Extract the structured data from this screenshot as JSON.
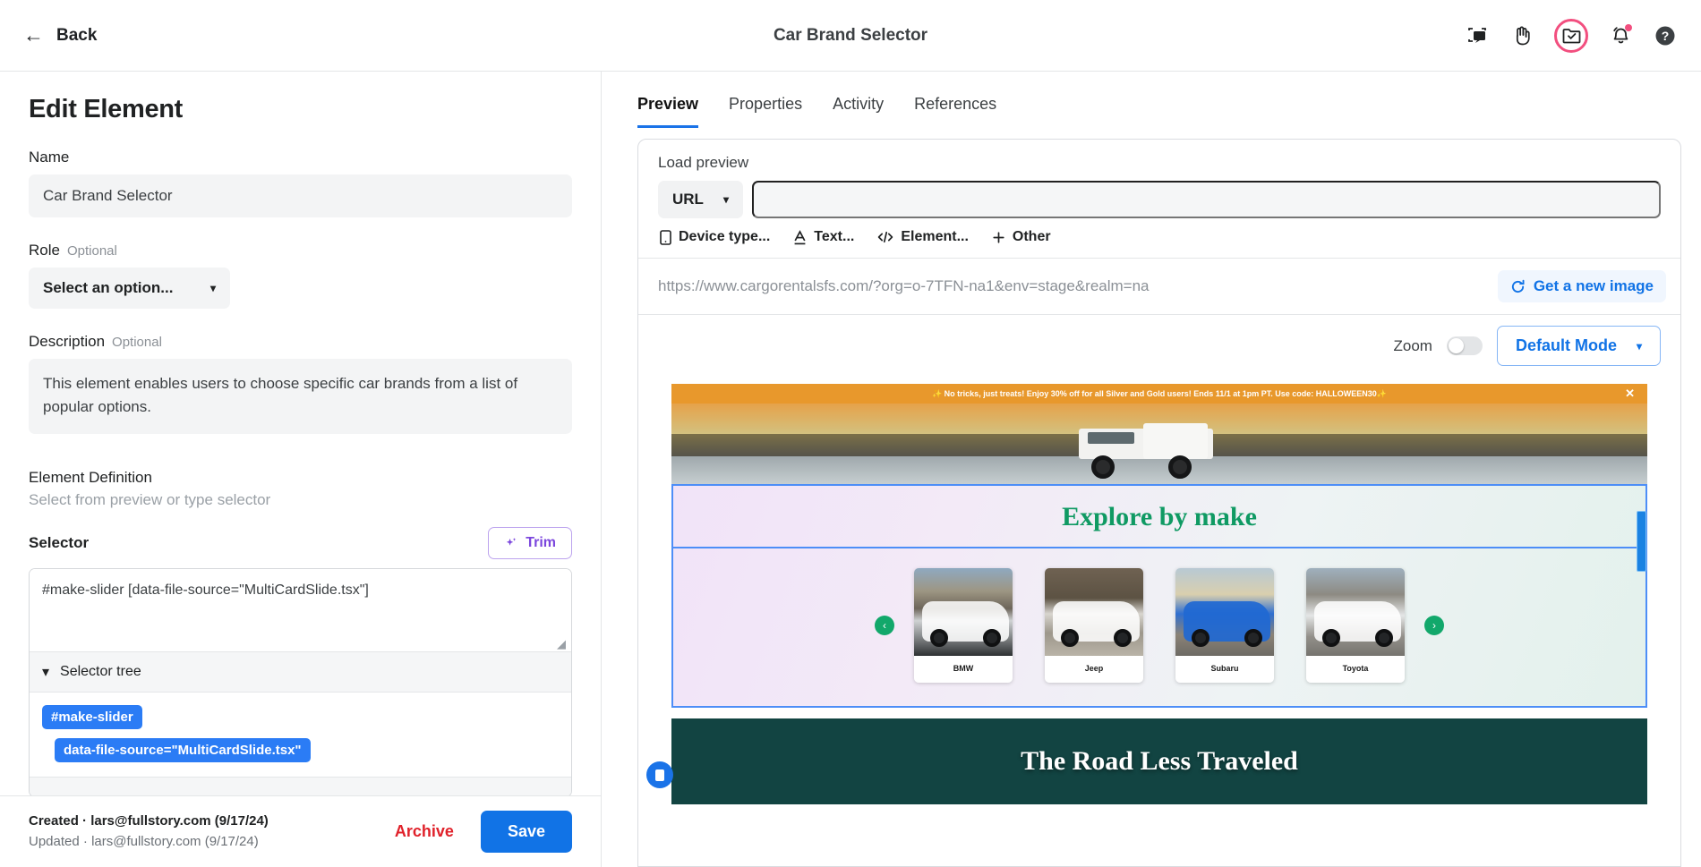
{
  "topbar": {
    "back_label": "Back",
    "app_title": "Car Brand Selector",
    "icons": [
      {
        "name": "screenshot-annotate-icon",
        "title": "Annotate"
      },
      {
        "name": "hand-icon",
        "title": "Hand"
      },
      {
        "name": "folder-check-icon",
        "title": "Saved"
      },
      {
        "name": "bell-icon",
        "title": "Notifications"
      },
      {
        "name": "help-icon",
        "title": "Help"
      }
    ]
  },
  "left": {
    "page_title": "Edit Element",
    "name_label": "Name",
    "name_value": "Car Brand Selector",
    "role_label": "Role",
    "role_optional": "Optional",
    "role_value": "Select an option...",
    "description_label": "Description",
    "description_optional": "Optional",
    "description_value": "This element enables users to choose specific car brands from a list of popular options.",
    "element_definition_label": "Element Definition",
    "element_definition_sub": "Select from preview or type selector",
    "selector_label": "Selector",
    "trim_label": "Trim",
    "selector_value": "#make-slider [data-file-source=\"MultiCardSlide.tsx\"]",
    "selector_tree_label": "Selector tree",
    "selector_tree_chips": [
      "#make-slider",
      "data-file-source=\"MultiCardSlide.tsx\""
    ],
    "footer": {
      "created_key": "Created",
      "created_value": "lars@fullstory.com (9/17/24)",
      "updated_key": "Updated",
      "updated_value": "lars@fullstory.com (9/17/24)",
      "archive_label": "Archive",
      "save_label": "Save"
    }
  },
  "right": {
    "tabs": [
      {
        "label": "Preview",
        "active": true
      },
      {
        "label": "Properties",
        "active": false
      },
      {
        "label": "Activity",
        "active": false
      },
      {
        "label": "References",
        "active": false
      }
    ],
    "load_preview_label": "Load preview",
    "url_select_value": "URL",
    "url_input_value": "",
    "filters": [
      {
        "label": "Device type...",
        "icon": "device-icon"
      },
      {
        "label": "Text...",
        "icon": "text-icon"
      },
      {
        "label": "Element...",
        "icon": "code-icon"
      },
      {
        "label": "Other",
        "icon": "plus-icon"
      }
    ],
    "url_display": "https://www.cargorentalsfs.com/?org=o-7TFN-na1&env=stage&realm=na",
    "get_new_image_label": "Get a new image",
    "zoom_label": "Zoom",
    "zoom_enabled": false,
    "mode_label": "Default Mode"
  },
  "preview_site": {
    "promo_text": "✨ No tricks, just treats! Enjoy 30% off for all Silver and Gold users! Ends 11/1 at 1pm PT. Use code: HALLOWEEN30✨",
    "promo_close": "✕",
    "explore_title": "Explore by make",
    "prev_arrow": "‹",
    "next_arrow": "›",
    "cards": [
      {
        "label": "BMW",
        "image_class": "cimg-bmw",
        "silhouette": "white"
      },
      {
        "label": "Jeep",
        "image_class": "cimg-jeep",
        "silhouette": "white"
      },
      {
        "label": "Subaru",
        "image_class": "cimg-subaru",
        "silhouette": "blue"
      },
      {
        "label": "Toyota",
        "image_class": "cimg-toyota",
        "silhouette": "white"
      }
    ],
    "road_title": "The Road Less Traveled"
  },
  "colors": {
    "accent_blue": "#1173e6",
    "selection_blue": "#4d8ef7",
    "chip_blue": "#2b7cf5",
    "archive_red": "#e0212a",
    "trim_purple": "#7b46dd",
    "pink_ring": "#f24f7f",
    "promo_orange": "#e8982c",
    "explore_green": "#0f9a63",
    "road_teal": "#124442"
  }
}
